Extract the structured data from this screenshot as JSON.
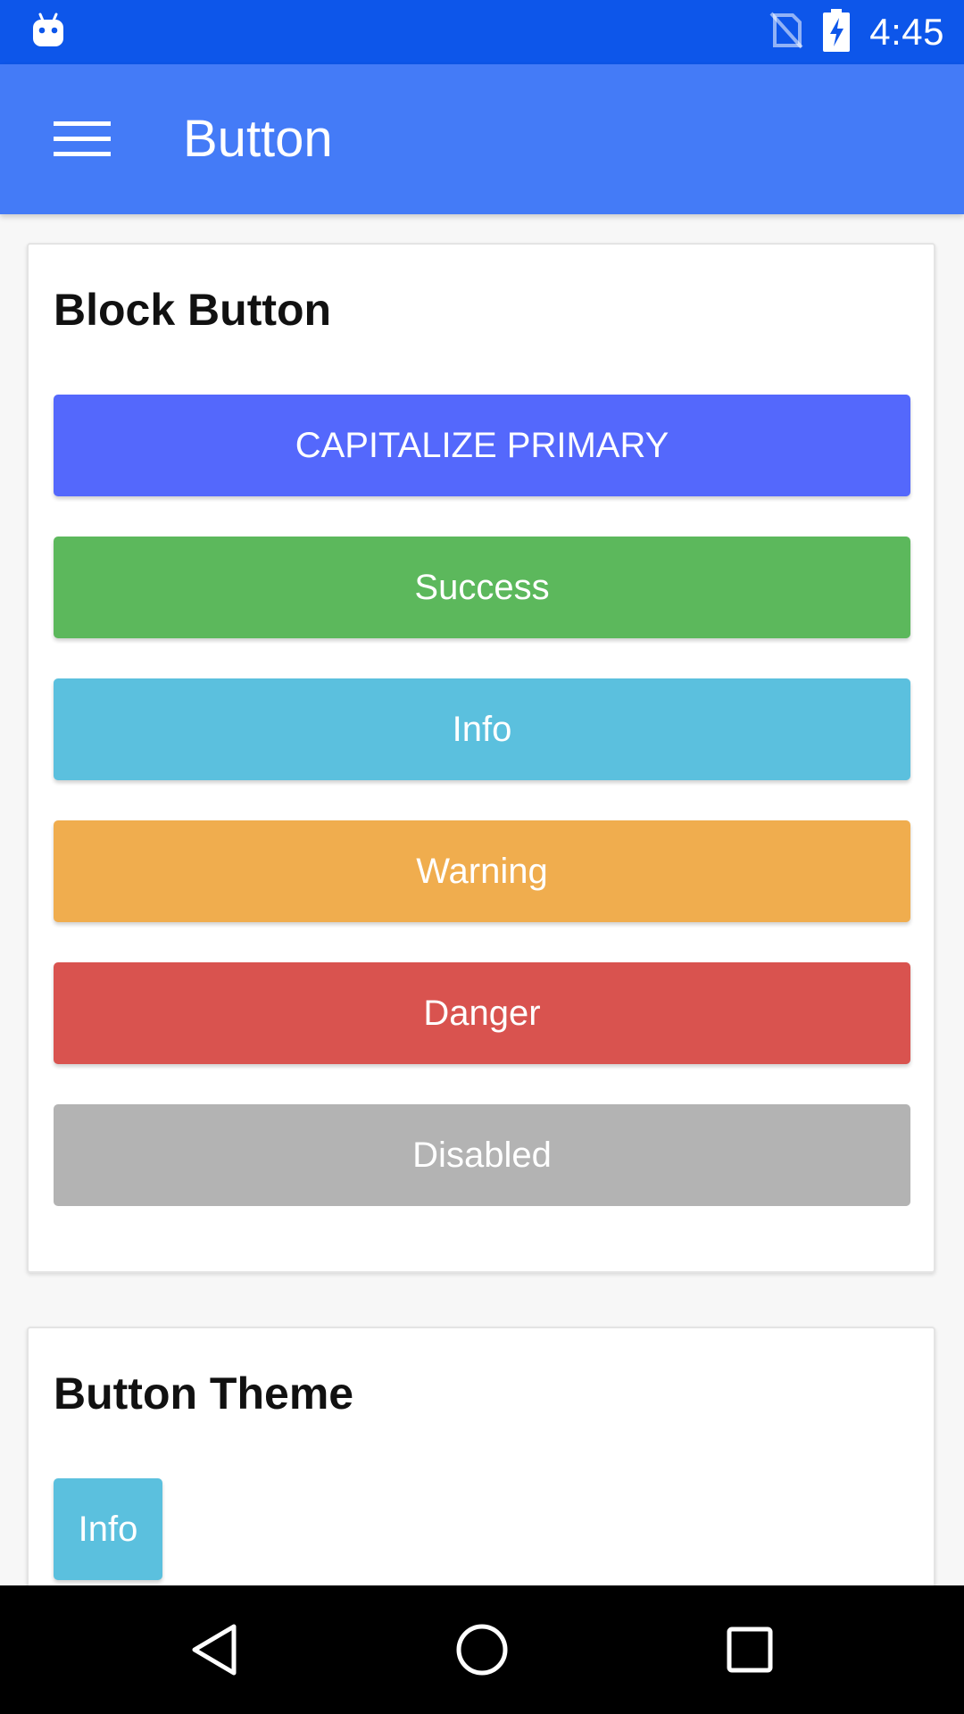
{
  "status_bar": {
    "time": "4:45",
    "icons": [
      "android-debug-icon",
      "no-sim-icon",
      "battery-charging-icon"
    ]
  },
  "app_bar": {
    "title": "Button",
    "menu_icon": "hamburger-menu-icon"
  },
  "block_card": {
    "title": "Block Button",
    "buttons": [
      {
        "label": "CAPITALIZE PRIMARY",
        "color": "#5468fc"
      },
      {
        "label": "Success",
        "color": "#5cb85c"
      },
      {
        "label": "Info",
        "color": "#5bc0de"
      },
      {
        "label": "Warning",
        "color": "#f0ad4e"
      },
      {
        "label": "Danger",
        "color": "#d9534f"
      },
      {
        "label": "Disabled",
        "color": "#b3b3b3"
      }
    ]
  },
  "theme_card": {
    "title": "Button Theme",
    "buttons": [
      {
        "label": "Info",
        "color": "#5bc0de"
      }
    ]
  },
  "nav_bar": {
    "icons": [
      "back-icon",
      "home-icon",
      "recents-icon"
    ]
  },
  "colors": {
    "status_bar": "#0d56ea",
    "app_bar": "#447bf7",
    "background": "#f7f7f7"
  }
}
